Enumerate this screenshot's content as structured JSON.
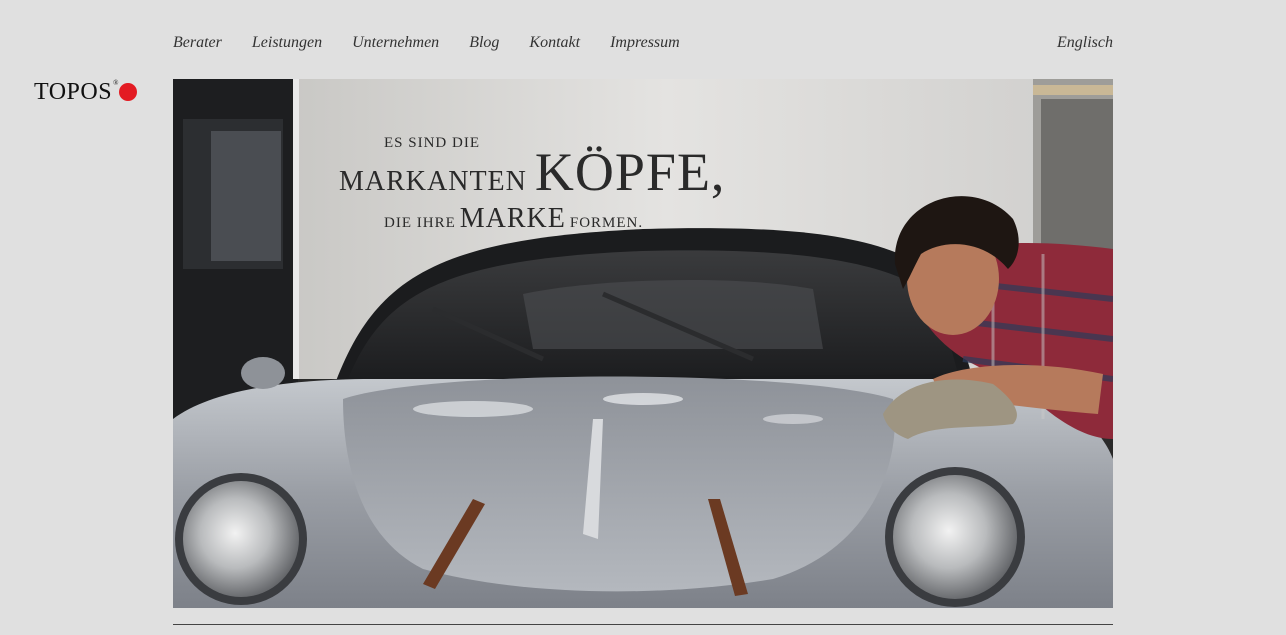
{
  "logo": {
    "text": "TOPOS",
    "reg": "®",
    "dot_color": "#e31b23"
  },
  "nav": {
    "items": [
      "Berater",
      "Leistungen",
      "Unternehmen",
      "Blog",
      "Kontakt",
      "Impressum"
    ],
    "language": "Englisch"
  },
  "hero": {
    "line1": "Es sind die",
    "line2_small": "markanten",
    "line2_big": "Köpfe,",
    "line3_small_a": "die ihre",
    "line3_mid": "Marke",
    "line3_small_b": "formen."
  }
}
